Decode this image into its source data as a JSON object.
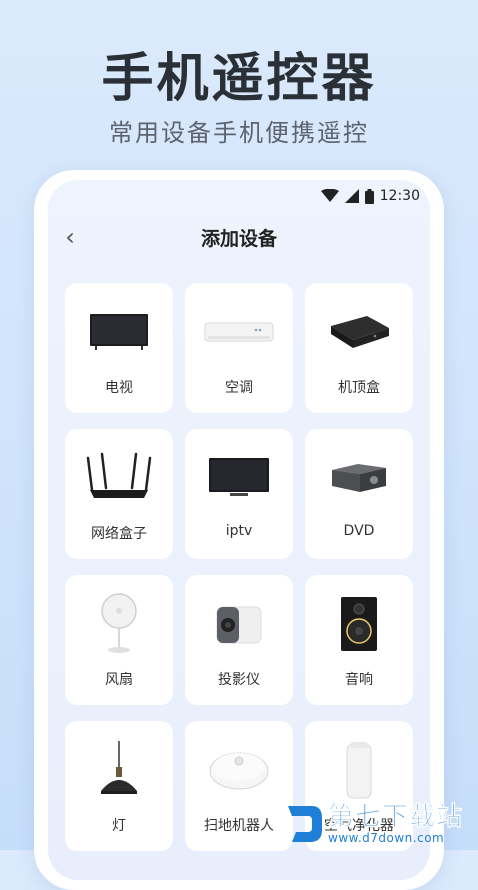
{
  "hero": {
    "title": "手机遥控器",
    "subtitle": "常用设备手机便携遥控"
  },
  "status_bar": {
    "time": "12:30",
    "icons": [
      "wifi-icon",
      "signal-icon",
      "battery-icon"
    ]
  },
  "nav": {
    "back_glyph": "‹",
    "title": "添加设备"
  },
  "devices": [
    {
      "label": "电视",
      "icon": "tv-icon"
    },
    {
      "label": "空调",
      "icon": "air-conditioner-icon"
    },
    {
      "label": "机顶盒",
      "icon": "set-top-box-icon"
    },
    {
      "label": "网络盒子",
      "icon": "router-icon"
    },
    {
      "label": "iptv",
      "icon": "iptv-icon"
    },
    {
      "label": "DVD",
      "icon": "dvd-player-icon"
    },
    {
      "label": "风扇",
      "icon": "fan-icon"
    },
    {
      "label": "投影仪",
      "icon": "projector-icon"
    },
    {
      "label": "音响",
      "icon": "speaker-icon"
    },
    {
      "label": "灯",
      "icon": "lamp-icon"
    },
    {
      "label": "扫地机器人",
      "icon": "robot-vacuum-icon"
    },
    {
      "label": "空气净化器",
      "icon": "air-purifier-icon"
    }
  ],
  "watermark": {
    "brand": "第七下载站",
    "url": "www.d7down.com"
  },
  "colors": {
    "background": "#d6e7fb",
    "card": "#ffffff",
    "watermark_blue": "#1f7fd6"
  }
}
